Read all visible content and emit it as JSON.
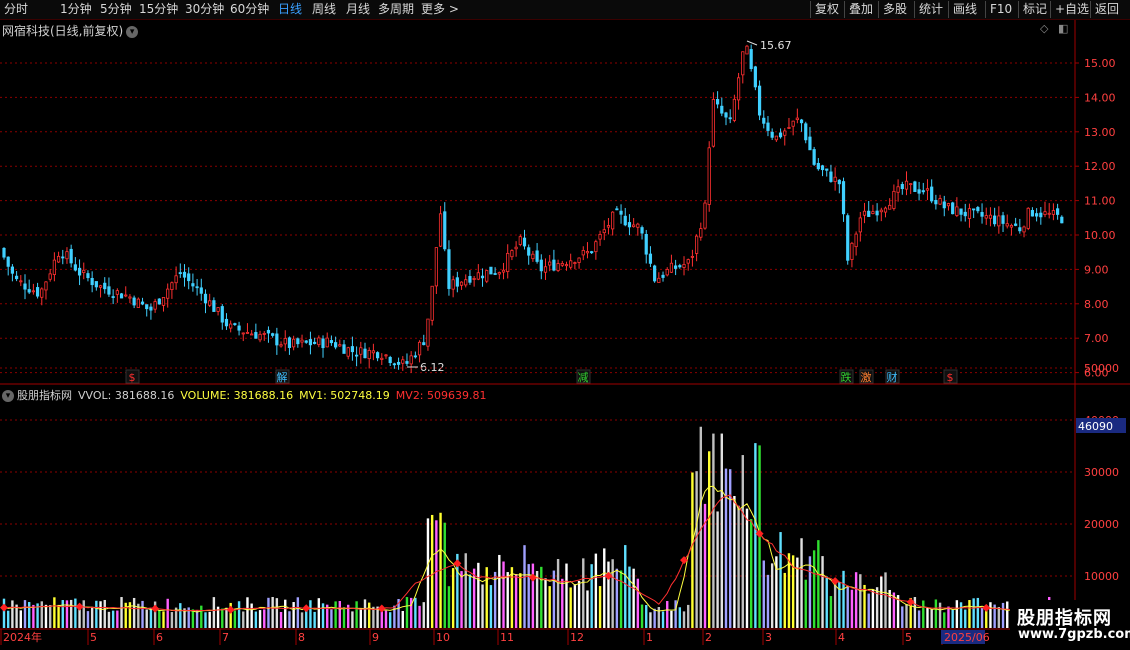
{
  "toolbar": {
    "periods": [
      "分时",
      "1分钟",
      "5分钟",
      "15分钟",
      "30分钟",
      "60分钟",
      "日线",
      "周线",
      "月线",
      "多周期",
      "更多 >"
    ],
    "active": "日线",
    "actions": [
      "复权",
      "叠加",
      "多股",
      "统计",
      "画线",
      "F10",
      "标记",
      "+自选",
      "返回"
    ]
  },
  "price_chart": {
    "title": "网宿科技(日线,前复权)",
    "y_ticks": [
      "15.00",
      "14.00",
      "13.00",
      "12.00",
      "11.00",
      "10.00",
      "9.00",
      "8.00",
      "7.00",
      "6.00"
    ],
    "high_label": "15.67",
    "low_label": "6.12",
    "event_markers": [
      {
        "text": "$",
        "color": "#ff3030"
      },
      {
        "text": "解",
        "color": "#40c0ff"
      },
      {
        "text": "减",
        "color": "#30d030"
      },
      {
        "text": "跌",
        "color": "#30d030"
      },
      {
        "text": "激",
        "color": "#ff8030"
      },
      {
        "text": "财",
        "color": "#40c0ff"
      },
      {
        "text": "$",
        "color": "#ff3030"
      }
    ]
  },
  "indicator": {
    "name": "股朋指标网",
    "vvol": "VVOL: 381688.16",
    "volume": "VOLUME: 381688.16",
    "mv1": "MV1: 502748.19",
    "mv2": "MV2: 509639.81",
    "y_ticks": [
      "50000",
      "40000",
      "30000",
      "20000",
      "10000"
    ],
    "cursor_value": "46090"
  },
  "x_axis": {
    "labels": [
      "2024年",
      "5",
      "6",
      "7",
      "8",
      "9",
      "10",
      "11",
      "12",
      "1",
      "2",
      "3",
      "4",
      "5",
      "2025/06"
    ]
  },
  "watermark": {
    "line1": "股朋指标网",
    "line2": "www.7gpzb.com"
  },
  "colors": {
    "up": "#ff3030",
    "down": "#40d0ff",
    "grid": "#8b0000",
    "mv1": "#ffff40",
    "mv2": "#ff3030"
  }
}
